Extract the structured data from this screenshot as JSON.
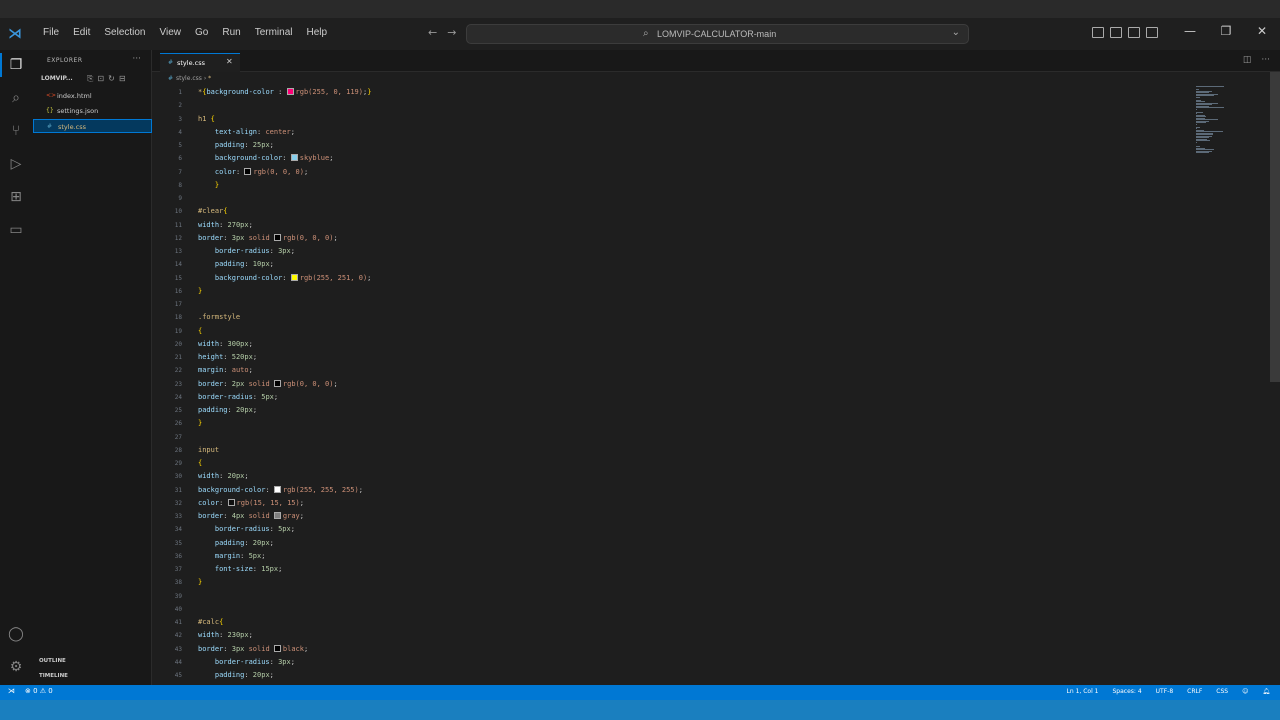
{
  "menu": [
    "File",
    "Edit",
    "Selection",
    "View",
    "Go",
    "Run",
    "Terminal",
    "Help"
  ],
  "command_center": {
    "text": "LOMVIP-CALCULATOR-main"
  },
  "explorer": {
    "title": "EXPLORER",
    "folder": "LOMVIP...",
    "files": [
      {
        "name": "index.html",
        "icon": "<>",
        "color": "#e44d26"
      },
      {
        "name": "settings.json",
        "icon": "{}",
        "color": "#cbcb41"
      },
      {
        "name": "style.css",
        "icon": "#",
        "color": "#519aba",
        "selected": true
      }
    ],
    "sections": [
      "OUTLINE",
      "TIMELINE"
    ]
  },
  "tab": {
    "name": "style.css"
  },
  "breadcrumb": {
    "icon": "#",
    "file": "style.css",
    "sep": "›",
    "sym": "*"
  },
  "code_lines": [
    [
      [
        "sel",
        "*"
      ],
      [
        "brace",
        "{"
      ],
      [
        "prop",
        "background-color"
      ],
      [
        "punc",
        " : "
      ],
      [
        "sw",
        "#ff0077"
      ],
      [
        "val",
        "rgb(255, 0, 119)"
      ],
      [
        "punc",
        ";"
      ],
      [
        "brace",
        "}"
      ]
    ],
    [],
    [
      [
        "sel",
        "h1 "
      ],
      [
        "brace",
        "{"
      ]
    ],
    [
      [
        "prop",
        "    text-align"
      ],
      [
        "punc",
        ": "
      ],
      [
        "val",
        "center"
      ],
      [
        "punc",
        ";"
      ]
    ],
    [
      [
        "prop",
        "    padding"
      ],
      [
        "punc",
        ": "
      ],
      [
        "num",
        "25px"
      ],
      [
        "punc",
        ";"
      ]
    ],
    [
      [
        "prop",
        "    background-color"
      ],
      [
        "punc",
        ": "
      ],
      [
        "sw",
        "#87ceeb"
      ],
      [
        "val",
        "skyblue"
      ],
      [
        "punc",
        ";"
      ]
    ],
    [
      [
        "prop",
        "    color"
      ],
      [
        "punc",
        ": "
      ],
      [
        "sw",
        "#000000"
      ],
      [
        "val",
        "rgb(0, 0, 0)"
      ],
      [
        "punc",
        ";"
      ]
    ],
    [
      [
        "brace",
        "    }"
      ]
    ],
    [],
    [
      [
        "sel",
        "#clear"
      ],
      [
        "brace",
        "{"
      ]
    ],
    [
      [
        "prop",
        "width"
      ],
      [
        "punc",
        ": "
      ],
      [
        "num",
        "270px"
      ],
      [
        "punc",
        ";"
      ]
    ],
    [
      [
        "prop",
        "border"
      ],
      [
        "punc",
        ": "
      ],
      [
        "num",
        "3px "
      ],
      [
        "val",
        "solid "
      ],
      [
        "sw",
        "#000000"
      ],
      [
        "val",
        "rgb(0, 0, 0)"
      ],
      [
        "punc",
        ";"
      ]
    ],
    [
      [
        "prop",
        "    border-radius"
      ],
      [
        "punc",
        ": "
      ],
      [
        "num",
        "3px"
      ],
      [
        "punc",
        ";"
      ]
    ],
    [
      [
        "prop",
        "    padding"
      ],
      [
        "punc",
        ": "
      ],
      [
        "num",
        "10px"
      ],
      [
        "punc",
        ";"
      ]
    ],
    [
      [
        "prop",
        "    background-color"
      ],
      [
        "punc",
        ": "
      ],
      [
        "sw",
        "#fffb00"
      ],
      [
        "val",
        "rgb(255, 251, 0)"
      ],
      [
        "punc",
        ";"
      ]
    ],
    [
      [
        "brace",
        "}"
      ]
    ],
    [],
    [
      [
        "sel",
        ".formstyle"
      ]
    ],
    [
      [
        "brace",
        "{"
      ]
    ],
    [
      [
        "prop",
        "width"
      ],
      [
        "punc",
        ": "
      ],
      [
        "num",
        "300px"
      ],
      [
        "punc",
        ";"
      ]
    ],
    [
      [
        "prop",
        "height"
      ],
      [
        "punc",
        ": "
      ],
      [
        "num",
        "520px"
      ],
      [
        "punc",
        ";"
      ]
    ],
    [
      [
        "prop",
        "margin"
      ],
      [
        "punc",
        ": "
      ],
      [
        "val",
        "auto"
      ],
      [
        "punc",
        ";"
      ]
    ],
    [
      [
        "prop",
        "border"
      ],
      [
        "punc",
        ": "
      ],
      [
        "num",
        "2px "
      ],
      [
        "val",
        "solid "
      ],
      [
        "sw",
        "#000000"
      ],
      [
        "val",
        "rgb(0, 0, 0)"
      ],
      [
        "punc",
        ";"
      ]
    ],
    [
      [
        "prop",
        "border-radius"
      ],
      [
        "punc",
        ": "
      ],
      [
        "num",
        "5px"
      ],
      [
        "punc",
        ";"
      ]
    ],
    [
      [
        "prop",
        "padding"
      ],
      [
        "punc",
        ": "
      ],
      [
        "num",
        "20px"
      ],
      [
        "punc",
        ";"
      ]
    ],
    [
      [
        "brace",
        "}"
      ]
    ],
    [],
    [
      [
        "sel",
        "input"
      ]
    ],
    [
      [
        "brace",
        "{"
      ]
    ],
    [
      [
        "prop",
        "width"
      ],
      [
        "punc",
        ": "
      ],
      [
        "num",
        "20px"
      ],
      [
        "punc",
        ";"
      ]
    ],
    [
      [
        "prop",
        "background-color"
      ],
      [
        "punc",
        ": "
      ],
      [
        "sw",
        "#ffffff"
      ],
      [
        "val",
        "rgb(255, 255, 255)"
      ],
      [
        "punc",
        ";"
      ]
    ],
    [
      [
        "prop",
        "color"
      ],
      [
        "punc",
        ": "
      ],
      [
        "sw",
        "#0f0f0f"
      ],
      [
        "val",
        "rgb(15, 15, 15)"
      ],
      [
        "punc",
        ";"
      ]
    ],
    [
      [
        "prop",
        "border"
      ],
      [
        "punc",
        ": "
      ],
      [
        "num",
        "4px "
      ],
      [
        "val",
        "solid "
      ],
      [
        "sw",
        "#808080"
      ],
      [
        "val",
        "gray"
      ],
      [
        "punc",
        ";"
      ]
    ],
    [
      [
        "prop",
        "    border-radius"
      ],
      [
        "punc",
        ": "
      ],
      [
        "num",
        "5px"
      ],
      [
        "punc",
        ";"
      ]
    ],
    [
      [
        "prop",
        "    padding"
      ],
      [
        "punc",
        ": "
      ],
      [
        "num",
        "20px"
      ],
      [
        "punc",
        ";"
      ]
    ],
    [
      [
        "prop",
        "    margin"
      ],
      [
        "punc",
        ": "
      ],
      [
        "num",
        "5px"
      ],
      [
        "punc",
        ";"
      ]
    ],
    [
      [
        "prop",
        "    font-size"
      ],
      [
        "punc",
        ": "
      ],
      [
        "num",
        "15px"
      ],
      [
        "punc",
        ";"
      ]
    ],
    [
      [
        "brace",
        "}"
      ]
    ],
    [],
    [],
    [
      [
        "sel",
        "#calc"
      ],
      [
        "brace",
        "{"
      ]
    ],
    [
      [
        "prop",
        "width"
      ],
      [
        "punc",
        ": "
      ],
      [
        "num",
        "230px"
      ],
      [
        "punc",
        ";"
      ]
    ],
    [
      [
        "prop",
        "border"
      ],
      [
        "punc",
        ": "
      ],
      [
        "num",
        "3px "
      ],
      [
        "val",
        "solid "
      ],
      [
        "sw",
        "#000000"
      ],
      [
        "val",
        "black"
      ],
      [
        "punc",
        ";"
      ]
    ],
    [
      [
        "prop",
        "    border-radius"
      ],
      [
        "punc",
        ": "
      ],
      [
        "num",
        "3px"
      ],
      [
        "punc",
        ";"
      ]
    ],
    [
      [
        "prop",
        "    padding"
      ],
      [
        "punc",
        ": "
      ],
      [
        "num",
        "20px"
      ],
      [
        "punc",
        ";"
      ]
    ]
  ],
  "status": {
    "errors": "⊗ 0  ⚠ 0",
    "position": "Ln 1, Col 1",
    "spaces": "Spaces: 4",
    "encoding": "UTF-8",
    "eol": "CRLF",
    "language": "CSS"
  }
}
